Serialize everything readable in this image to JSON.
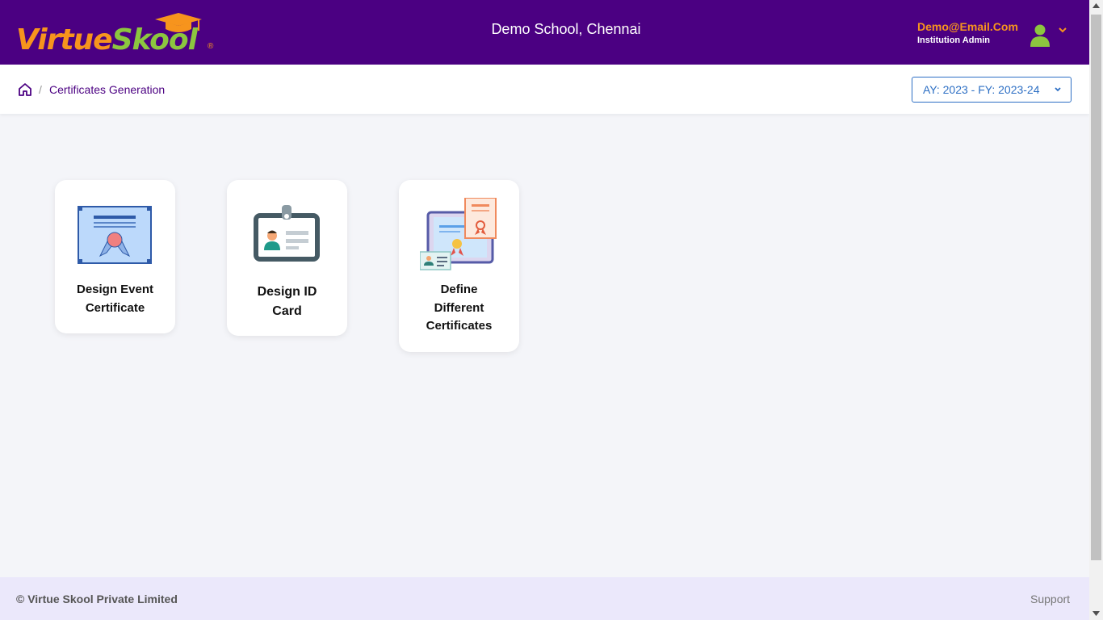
{
  "header": {
    "logo_part1": "Virtue",
    "logo_part2": "Skool",
    "logo_registered": "®",
    "school_name": "Demo School, Chennai",
    "user_email": "Demo@Email.Com",
    "user_role": "Institution Admin"
  },
  "breadcrumb": {
    "separator": "/",
    "current": "Certificates Generation"
  },
  "year_selector": {
    "value": "AY: 2023 - FY: 2023-24"
  },
  "cards": [
    {
      "title": "Design Event Certificate",
      "icon": "event-certificate-icon"
    },
    {
      "title": "Design ID Card",
      "icon": "id-card-icon"
    },
    {
      "title": "Define Different Certificates",
      "icon": "certificates-icon"
    }
  ],
  "footer": {
    "copyright": "© Virtue Skool Private Limited",
    "support": "Support"
  },
  "colors": {
    "header_bg": "#4b0082",
    "brand_orange": "#f7941d",
    "brand_green": "#8cc63f",
    "accent_blue": "#2d6fc4",
    "footer_bg": "#ebe8fb"
  }
}
